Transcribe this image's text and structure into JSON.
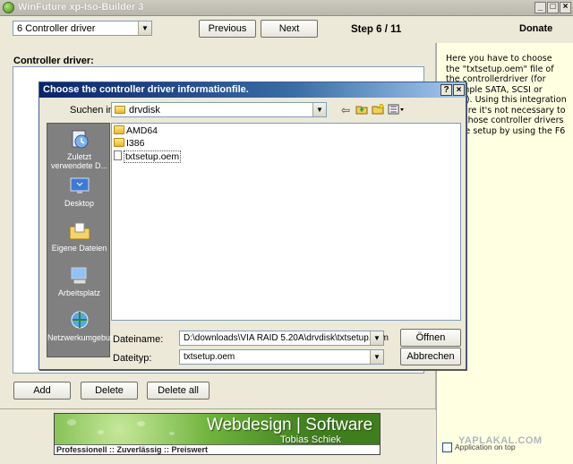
{
  "window": {
    "title": "WinFuture xp-Iso-Builder 3",
    "min_glyph": "_",
    "max_glyph": "□",
    "close_glyph": "×"
  },
  "toolbar": {
    "step_select_value": "6 Controller driver",
    "previous_label": "Previous",
    "next_label": "Next",
    "step_text": "Step 6 / 11",
    "donate_label": "Donate"
  },
  "main": {
    "section_label": "Controller driver:",
    "add_label": "Add",
    "delete_label": "Delete",
    "delete_all_label": "Delete all"
  },
  "help": {
    "text": "Here you have to choose the \"txtsetup.oem\" file of the controllerdriver (for example SATA, SCSI or RAID). Using this integration feature it's not necessary to add those controller drivers in the setup by using the F6 key.",
    "app_on_top_label": "Application on top"
  },
  "banner": {
    "title": "Webdesign | Software",
    "name": "Tobias Schiek",
    "slogan": "Professionell :: Zuverlässig :: Preiswert"
  },
  "watermark": "YAPLAKAL.COM",
  "dialog": {
    "title": "Choose the controller driver informationfile.",
    "help_glyph": "?",
    "close_glyph": "×",
    "look_in_label": "Suchen in:",
    "look_in_value": "drvdisk",
    "places": [
      {
        "label": "Zuletzt verwendete D...",
        "icon": "recent-documents-icon"
      },
      {
        "label": "Desktop",
        "icon": "desktop-icon"
      },
      {
        "label": "Eigene Dateien",
        "icon": "my-documents-icon"
      },
      {
        "label": "Arbeitsplatz",
        "icon": "my-computer-icon"
      },
      {
        "label": "Netzwerkumgebung",
        "icon": "network-places-icon"
      }
    ],
    "files": [
      {
        "name": "AMD64",
        "type": "folder"
      },
      {
        "name": "I386",
        "type": "folder"
      },
      {
        "name": "txtsetup.oem",
        "type": "file"
      }
    ],
    "filename_label": "Dateiname:",
    "filename_value": "D:\\downloads\\VIA RAID 5.20A\\drvdisk\\txtsetup.oem",
    "filetype_label": "Dateityp:",
    "filetype_value": "txtsetup.oem",
    "open_label": "Öffnen",
    "cancel_label": "Abbrechen"
  }
}
